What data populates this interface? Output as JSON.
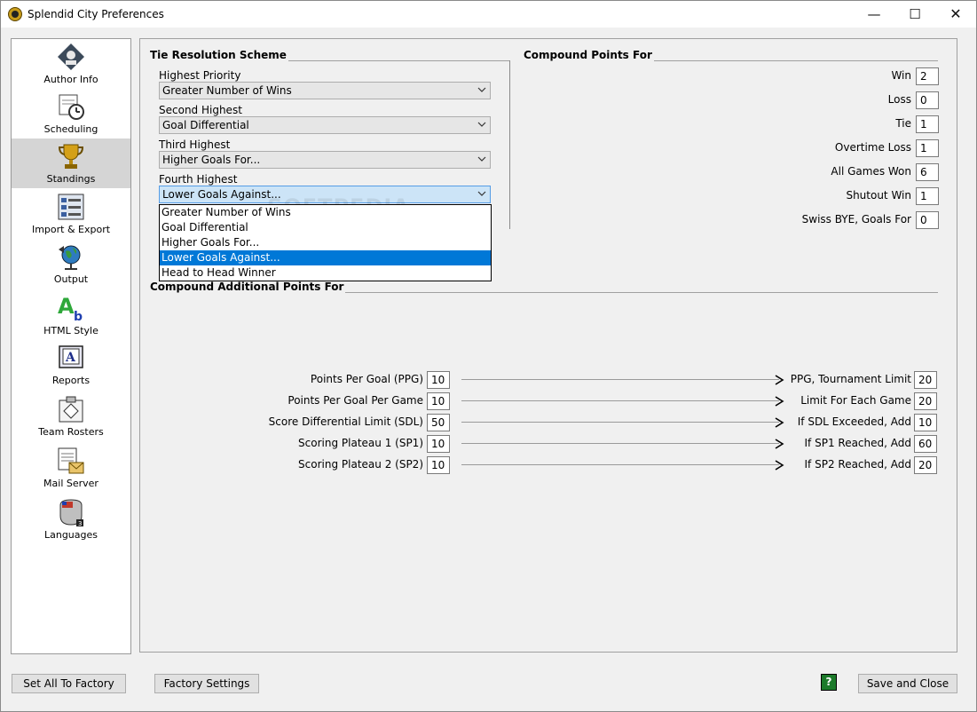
{
  "window": {
    "title": "Splendid City Preferences",
    "minimize": "—",
    "maximize": "☐",
    "close": "✕"
  },
  "sidebar": {
    "items": [
      {
        "label": "Author Info",
        "icon": "author-info-icon"
      },
      {
        "label": "Scheduling",
        "icon": "scheduling-icon"
      },
      {
        "label": "Standings",
        "icon": "trophy-icon",
        "active": true
      },
      {
        "label": "Import & Export",
        "icon": "import-export-icon"
      },
      {
        "label": "Output",
        "icon": "globe-icon"
      },
      {
        "label": "HTML Style",
        "icon": "html-style-icon"
      },
      {
        "label": "Reports",
        "icon": "reports-icon"
      },
      {
        "label": "Team Rosters",
        "icon": "team-rosters-icon"
      },
      {
        "label": "Mail Server",
        "icon": "mail-server-icon"
      },
      {
        "label": "Languages",
        "icon": "languages-icon"
      }
    ]
  },
  "tie": {
    "title": "Tie Resolution Scheme",
    "highest_label": "Highest Priority",
    "highest_value": "Greater Number of Wins",
    "second_label": "Second Highest",
    "second_value": "Goal Differential",
    "third_label": "Third Highest",
    "third_value": "Higher Goals For...",
    "fourth_label": "Fourth Highest",
    "fourth_value": "Lower Goals Against...",
    "options": [
      "Greater Number of Wins",
      "Goal Differential",
      "Higher Goals For...",
      "Lower Goals Against...",
      "Head to Head Winner"
    ],
    "selected_option": "Lower Goals Against..."
  },
  "compound": {
    "title": "Compound Points For",
    "win_label": "Win",
    "win": "2",
    "loss_label": "Loss",
    "loss": "0",
    "tie_label": "Tie",
    "tie": "1",
    "otl_label": "Overtime Loss",
    "otl": "1",
    "agw_label": "All Games Won",
    "agw": "6",
    "sow_label": "Shutout Win",
    "sow": "1",
    "swiss_label": "Swiss BYE, Goals For",
    "swiss": "0"
  },
  "additional": {
    "title": "Compound Additional Points For",
    "ppg_label": "Points Per Goal (PPG)",
    "ppg": "10",
    "ppgpg_label": "Points Per Goal Per Game",
    "ppgpg": "10",
    "sdl_label": "Score Differential Limit (SDL)",
    "sdl": "50",
    "sp1_label": "Scoring Plateau 1 (SP1)",
    "sp1": "10",
    "sp2_label": "Scoring Plateau 2 (SP2)",
    "sp2": "10",
    "ppg_limit_label": "PPG, Tournament Limit",
    "ppg_limit": "20",
    "game_limit_label": "Limit For Each Game",
    "game_limit": "20",
    "sdl_add_label": "If SDL Exceeded, Add",
    "sdl_add": "10",
    "sp1_add_label": "If SP1 Reached, Add",
    "sp1_add": "60",
    "sp2_add_label": "If SP2 Reached, Add",
    "sp2_add": "20"
  },
  "footer": {
    "set_all_factory": "Set All To Factory",
    "factory_settings": "Factory Settings",
    "help": "?",
    "save_close": "Save and Close"
  },
  "watermark": "SOFTPEDIA",
  "colors": {
    "selection": "#0078d7",
    "focused_combo": "#cce4f7",
    "active_sidebar": "#d5d5d5"
  }
}
